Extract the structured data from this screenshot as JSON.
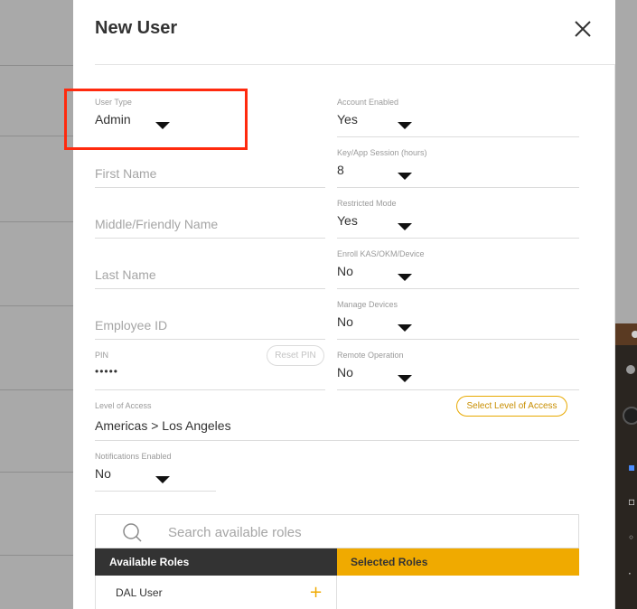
{
  "dialog": {
    "title": "New User"
  },
  "form": {
    "user_type": {
      "label": "User Type",
      "value": "Admin"
    },
    "account_enabled": {
      "label": "Account Enabled",
      "value": "Yes"
    },
    "key_app_session": {
      "label": "Key/App Session (hours)",
      "value": "8"
    },
    "restricted_mode": {
      "label": "Restricted Mode",
      "value": "Yes"
    },
    "enroll_kas": {
      "label": "Enroll KAS/OKM/Device",
      "value": "No"
    },
    "manage_devices": {
      "label": "Manage Devices",
      "value": "No"
    },
    "remote_operation": {
      "label": "Remote Operation",
      "value": "No"
    },
    "first_name": {
      "placeholder": "First Name"
    },
    "middle_name": {
      "placeholder": "Middle/Friendly Name"
    },
    "last_name": {
      "placeholder": "Last Name"
    },
    "employee_id": {
      "placeholder": "Employee ID"
    },
    "pin": {
      "label": "PIN",
      "value": "•••••",
      "reset_label": "Reset PIN"
    },
    "level_of_access": {
      "label": "Level of Access",
      "value": "Americas > Los Angeles",
      "select_label": "Select Level of Access"
    },
    "notifications_enabled": {
      "label": "Notifications Enabled",
      "value": "No"
    }
  },
  "roles": {
    "search_placeholder": "Search available roles",
    "available_header": "Available Roles",
    "selected_header": "Selected Roles",
    "available": [
      "DAL User"
    ]
  },
  "colors": {
    "accent": "#f0aa00",
    "dark_header": "#333333",
    "highlight": "#ff2a0e"
  }
}
